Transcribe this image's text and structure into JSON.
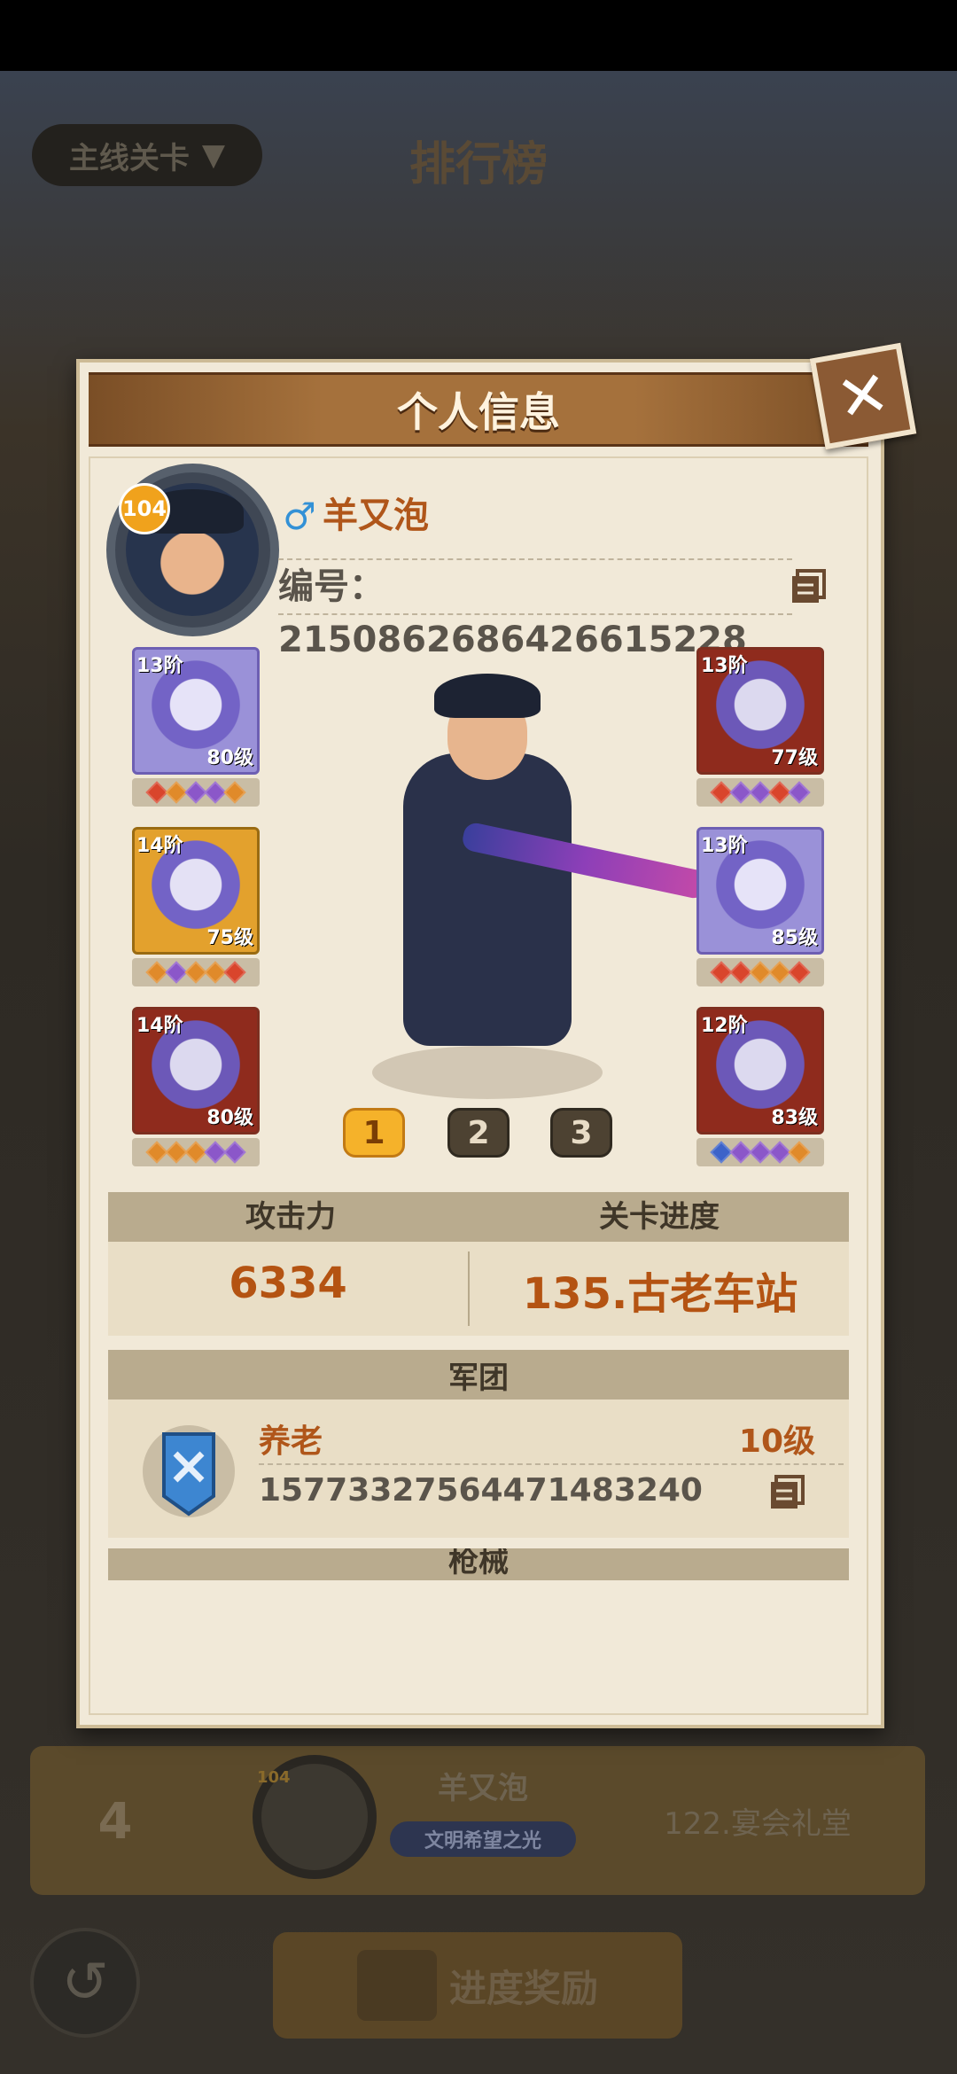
{
  "background": {
    "stage_dropdown": "主线关卡",
    "page_title": "排行榜",
    "row": {
      "rank": "4",
      "avatar_level": "104",
      "name": "羊又泡",
      "banner": "文明希望之光",
      "stage": "122.宴会礼堂"
    },
    "reward_button": "进度奖励"
  },
  "modal": {
    "title": "个人信息",
    "player": {
      "level": "104",
      "gender_symbol": "♂",
      "name": "羊又泡",
      "id_text": "编号：2150862686426615228"
    },
    "equipment_left": [
      {
        "tier": "13阶",
        "level": "80级",
        "gems": [
          "#d9452c",
          "#e08a2a",
          "#8b57c9",
          "#8b57c9",
          "#e08a2a"
        ],
        "frame": "blue"
      },
      {
        "tier": "14阶",
        "level": "75级",
        "gems": [
          "#e08a2a",
          "#8b57c9",
          "#e08a2a",
          "#e08a2a",
          "#d9452c"
        ],
        "frame": "gold"
      },
      {
        "tier": "14阶",
        "level": "80级",
        "gems": [
          "#e08a2a",
          "#e08a2a",
          "#e08a2a",
          "#8b57c9",
          "#8b57c9"
        ],
        "frame": "red"
      }
    ],
    "equipment_right": [
      {
        "tier": "13阶",
        "level": "77级",
        "gems": [
          "#d9452c",
          "#8b57c9",
          "#8b57c9",
          "#d9452c",
          "#8b57c9"
        ],
        "frame": "red"
      },
      {
        "tier": "13阶",
        "level": "85级",
        "gems": [
          "#d9452c",
          "#d9452c",
          "#e08a2a",
          "#e08a2a",
          "#d9452c"
        ],
        "frame": "blue"
      },
      {
        "tier": "12阶",
        "level": "83级",
        "gems": [
          "#3c63c9",
          "#8b57c9",
          "#8b57c9",
          "#8b57c9",
          "#e08a2a"
        ],
        "frame": "red"
      }
    ],
    "pages": [
      "1",
      "2",
      "3"
    ],
    "selected_page": "1",
    "stats": {
      "attack_label": "攻击力",
      "attack_value": "6334",
      "progress_label": "关卡进度",
      "progress_value": "135.古老车站"
    },
    "legion": {
      "section_title": "军团",
      "name": "养老",
      "level": "10级",
      "id": "15773327564471483240"
    },
    "weapons": {
      "section_title": "枪械"
    }
  }
}
